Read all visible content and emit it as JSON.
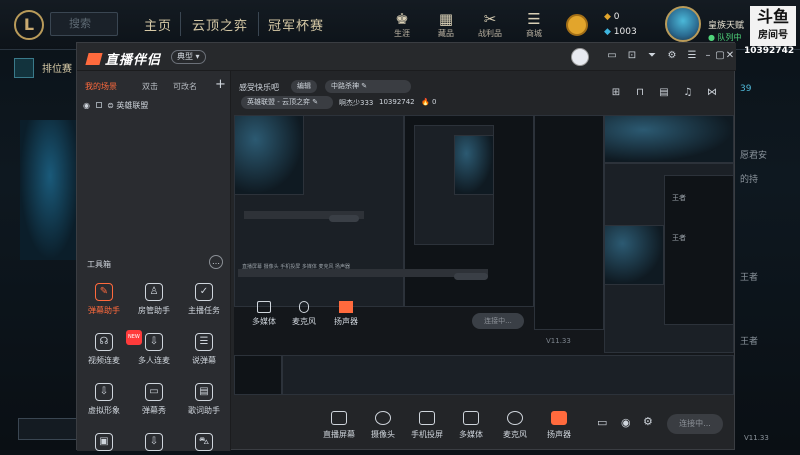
{
  "game": {
    "logo": "L",
    "search_placeholder": "搜索",
    "nav": [
      "主页",
      "云顶之弈",
      "冠军杯赛"
    ],
    "icons": [
      {
        "name": "life-icon",
        "label": "生涯"
      },
      {
        "name": "collection-icon",
        "label": "藏品"
      },
      {
        "name": "loot-icon",
        "label": "战利品"
      },
      {
        "name": "store-icon",
        "label": "商城"
      }
    ],
    "currency_gold": "0",
    "currency_blue": "1003",
    "player_name": "皇族天赋",
    "player_status": "● 队列中",
    "douyu_logo": "斗鱼",
    "douyu_sub": "房间号",
    "room_number": "10392742",
    "rank_label": "排位赛",
    "side_time": "39",
    "side_texts": [
      "愿君安",
      "的持",
      "王者",
      "王者"
    ],
    "bottom_time": "V11.33"
  },
  "app": {
    "brand": "直播伴侣",
    "mode_badge": "典型",
    "titlebar_icons": [
      "monitor-icon",
      "shirt-icon",
      "filter-icon",
      "settings-icon",
      "menu-icon",
      "minimize-icon",
      "maximize-icon",
      "close-icon"
    ],
    "left_tabs": [
      "我的场景",
      "双击",
      "可改名"
    ],
    "scene_item": "英雄联盟",
    "tools_title": "工具箱",
    "tools": [
      {
        "name": "danmu-assistant",
        "label": "弹幕助手",
        "glyph": "✎",
        "hot": true
      },
      {
        "name": "room-manager",
        "label": "房管助手",
        "glyph": "♙",
        "hot": false
      },
      {
        "name": "host-task",
        "label": "主播任务",
        "glyph": "✓",
        "hot": false
      },
      {
        "name": "video-link",
        "label": "视频连麦",
        "glyph": "☊",
        "hot": false,
        "tag": "NEW"
      },
      {
        "name": "multi-link",
        "label": "多人连麦",
        "glyph": "⇩",
        "hot": false
      },
      {
        "name": "lyric-danmu",
        "label": "说弹幕",
        "glyph": "☰",
        "hot": false
      },
      {
        "name": "virtual-avatar",
        "label": "虚拟形象",
        "glyph": "⇩",
        "hot": false
      },
      {
        "name": "danmu-show",
        "label": "弹幕秀",
        "glyph": "▭",
        "hot": false
      },
      {
        "name": "lyric-assistant",
        "label": "歌词助手",
        "glyph": "▤",
        "hot": false
      }
    ],
    "stream_title": "感受快乐吧",
    "title_tag": "编辑",
    "game_tag": "中路杀神",
    "category": "英雄联盟 - 云顶之弈",
    "streamer": "啊杰少333",
    "room_id": "10392742",
    "popularity": "0",
    "preview_icons": [
      "gift-icon",
      "lock-icon",
      "share-screen-icon",
      "bell-icon",
      "share-icon"
    ],
    "preview_time": "V11.33",
    "bottom_toolbar": [
      {
        "name": "live-screen",
        "label": "直播屏幕"
      },
      {
        "name": "camera",
        "label": "摄像头"
      },
      {
        "name": "phone-cast",
        "label": "手机投屏"
      },
      {
        "name": "multimedia",
        "label": "多媒体"
      },
      {
        "name": "microphone",
        "label": "麦克风"
      },
      {
        "name": "speaker",
        "label": "扬声器"
      }
    ],
    "connect_label": "连接中..."
  },
  "nested": {
    "toolbar_labels": [
      "多媒体",
      "麦克风",
      "扬声器"
    ],
    "connect_label": "连接中...",
    "time": "V11.33",
    "inner_labels": [
      "直播屏幕",
      "摄像头",
      "手机投屏",
      "多媒体",
      "麦克风",
      "扬声器"
    ]
  },
  "colors": {
    "accent": "#ff6a3d",
    "panel": "#2a2c30",
    "window": "#232528",
    "text": "#cfd5dc",
    "game_gold": "#d6c9a6",
    "status_green": "#4fd37a"
  }
}
